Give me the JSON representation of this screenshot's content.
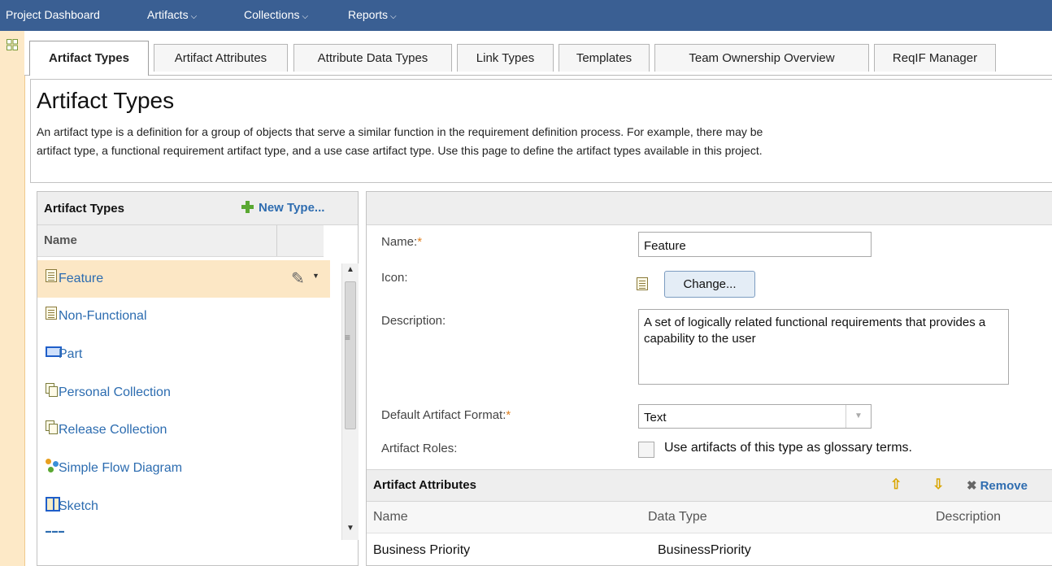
{
  "nav": {
    "items": [
      {
        "label": "Project Dashboard"
      },
      {
        "label": "Artifacts"
      },
      {
        "label": "Collections"
      },
      {
        "label": "Reports"
      }
    ]
  },
  "tabs": [
    {
      "label": "Artifact Types",
      "active": true
    },
    {
      "label": "Artifact Attributes"
    },
    {
      "label": "Attribute Data Types"
    },
    {
      "label": "Link Types"
    },
    {
      "label": "Templates"
    },
    {
      "label": "Team Ownership Overview"
    },
    {
      "label": "ReqIF Manager"
    }
  ],
  "page": {
    "title": "Artifact Types",
    "description_line1": "An artifact type is a definition for a group of objects that serve a similar function in the requirement definition process. For example, there may be",
    "description_line2": "artifact type, a functional requirement artifact type, and a use case artifact type. Use this page to define the artifact types available in this project."
  },
  "types_panel": {
    "title": "Artifact Types",
    "new_button": "New Type...",
    "column_name": "Name",
    "items": [
      {
        "label": "Feature",
        "icon": "requirement-doc-icon",
        "selected": true
      },
      {
        "label": "Non-Functional",
        "icon": "requirement-doc-icon"
      },
      {
        "label": "Part",
        "icon": "part-icon"
      },
      {
        "label": "Personal Collection",
        "icon": "collection-icon"
      },
      {
        "label": "Release Collection",
        "icon": "collection-icon"
      },
      {
        "label": "Simple Flow Diagram",
        "icon": "flow-diagram-icon"
      },
      {
        "label": "Sketch",
        "icon": "sketch-icon"
      },
      {
        "label": "",
        "icon": "storyboard-icon"
      }
    ]
  },
  "details": {
    "name_label": "Name:",
    "name_value": "Feature",
    "icon_label": "Icon:",
    "change_button": "Change...",
    "description_label": "Description:",
    "description_value": "A set of logically related functional requirements that provides a capability to the user",
    "format_label": "Default Artifact Format:",
    "format_value": "Text",
    "roles_label": "Artifact Roles:",
    "glossary_checkbox_label": "Use artifacts of this type as glossary terms.",
    "glossary_checked": false,
    "required_marker": "*"
  },
  "attributes": {
    "title": "Artifact Attributes",
    "remove_label": "Remove",
    "columns": [
      "Name",
      "Data Type",
      "Description"
    ],
    "rows": [
      {
        "name": "Business Priority",
        "data_type": "BusinessPriority",
        "description": ""
      }
    ]
  },
  "colors": {
    "nav_bg": "#3a5f93",
    "link": "#2c6cb0",
    "selected_row": "#fce7c5",
    "required": "#e08020"
  }
}
